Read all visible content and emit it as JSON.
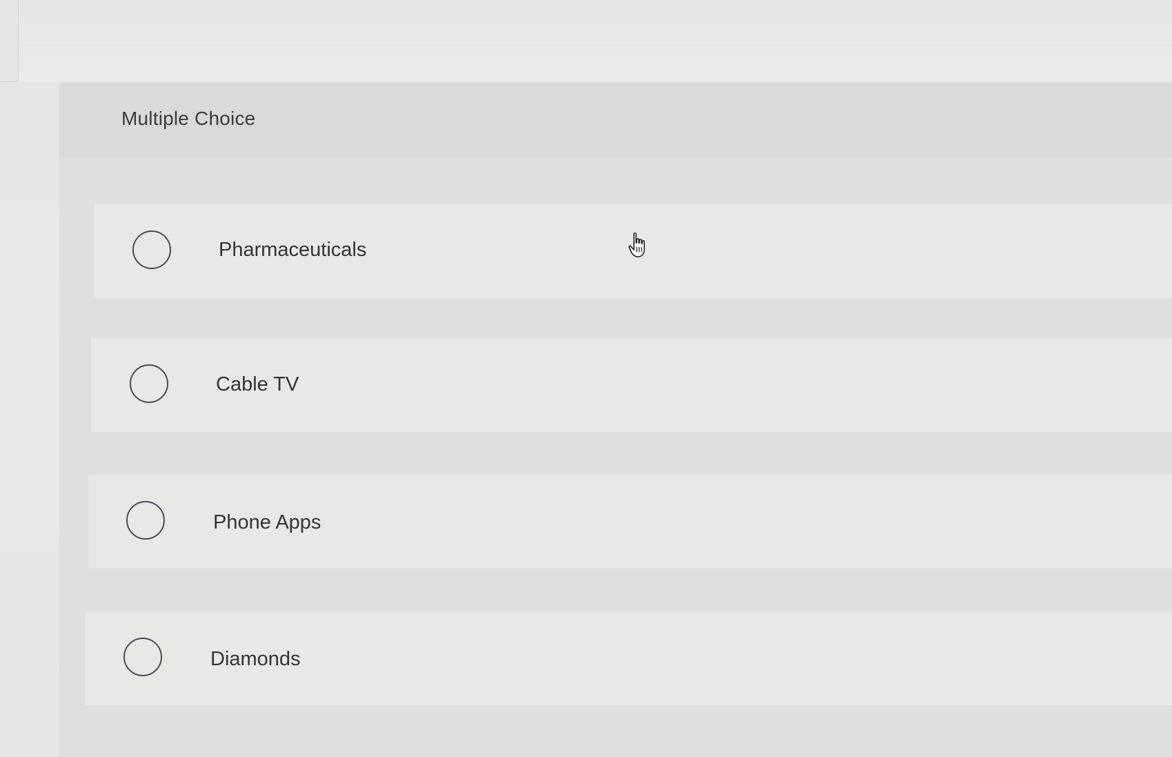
{
  "question": {
    "type_label": "Multiple Choice"
  },
  "options": [
    {
      "label": "Pharmaceuticals",
      "selected": false
    },
    {
      "label": "Cable TV",
      "selected": false
    },
    {
      "label": "Phone Apps",
      "selected": false
    },
    {
      "label": "Diamonds",
      "selected": false
    }
  ],
  "icons": {
    "radio": "radio-circle-icon",
    "cursor": "hand-pointer-icon"
  },
  "colors": {
    "radio_border": "#474b55",
    "text": "#333333",
    "background": "#e8e8e6"
  }
}
